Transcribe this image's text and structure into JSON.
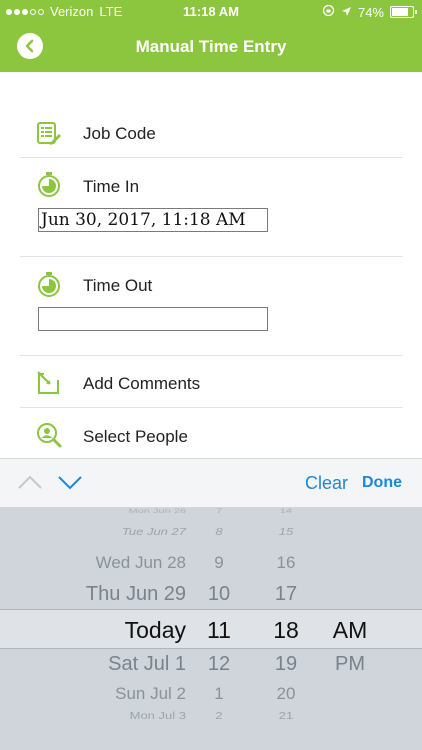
{
  "status_bar": {
    "carrier": "Verizon",
    "network": "LTE",
    "time": "11:18 AM",
    "battery": "74%",
    "battery_level": 0.74
  },
  "header": {
    "title": "Manual Time Entry"
  },
  "form": {
    "job_code_label": "Job Code",
    "time_in_label": "Time In",
    "time_in_value": "Jun 30, 2017, 11:18 AM",
    "time_out_label": "Time Out",
    "time_out_value": "",
    "add_comments_label": "Add Comments",
    "select_people_label": "Select People"
  },
  "toolbar": {
    "clear_label": "Clear",
    "done_label": "Done"
  },
  "picker": {
    "dates": [
      "Mon Jun 26",
      "Tue Jun 27",
      "Wed Jun 28",
      "Thu Jun 29",
      "Today",
      "Sat Jul 1",
      "Sun Jul 2",
      "Mon Jul 3"
    ],
    "hours": [
      "7",
      "8",
      "9",
      "10",
      "11",
      "12",
      "1",
      "2"
    ],
    "minutes": [
      "14",
      "15",
      "16",
      "17",
      "18",
      "19",
      "20",
      "21"
    ],
    "ampm": [
      "AM",
      "PM"
    ]
  },
  "colors": {
    "accent": "#8cc63f",
    "link": "#1e87d8"
  },
  "icons": {
    "back": "chevron-left-icon",
    "job_code": "list-edit-icon",
    "time_in": "stopwatch-icon",
    "time_out": "stopwatch-icon",
    "add_comments": "edit-arrow-icon",
    "select_people": "people-search-icon",
    "previous": "chevron-up-icon",
    "next": "chevron-down-icon"
  }
}
